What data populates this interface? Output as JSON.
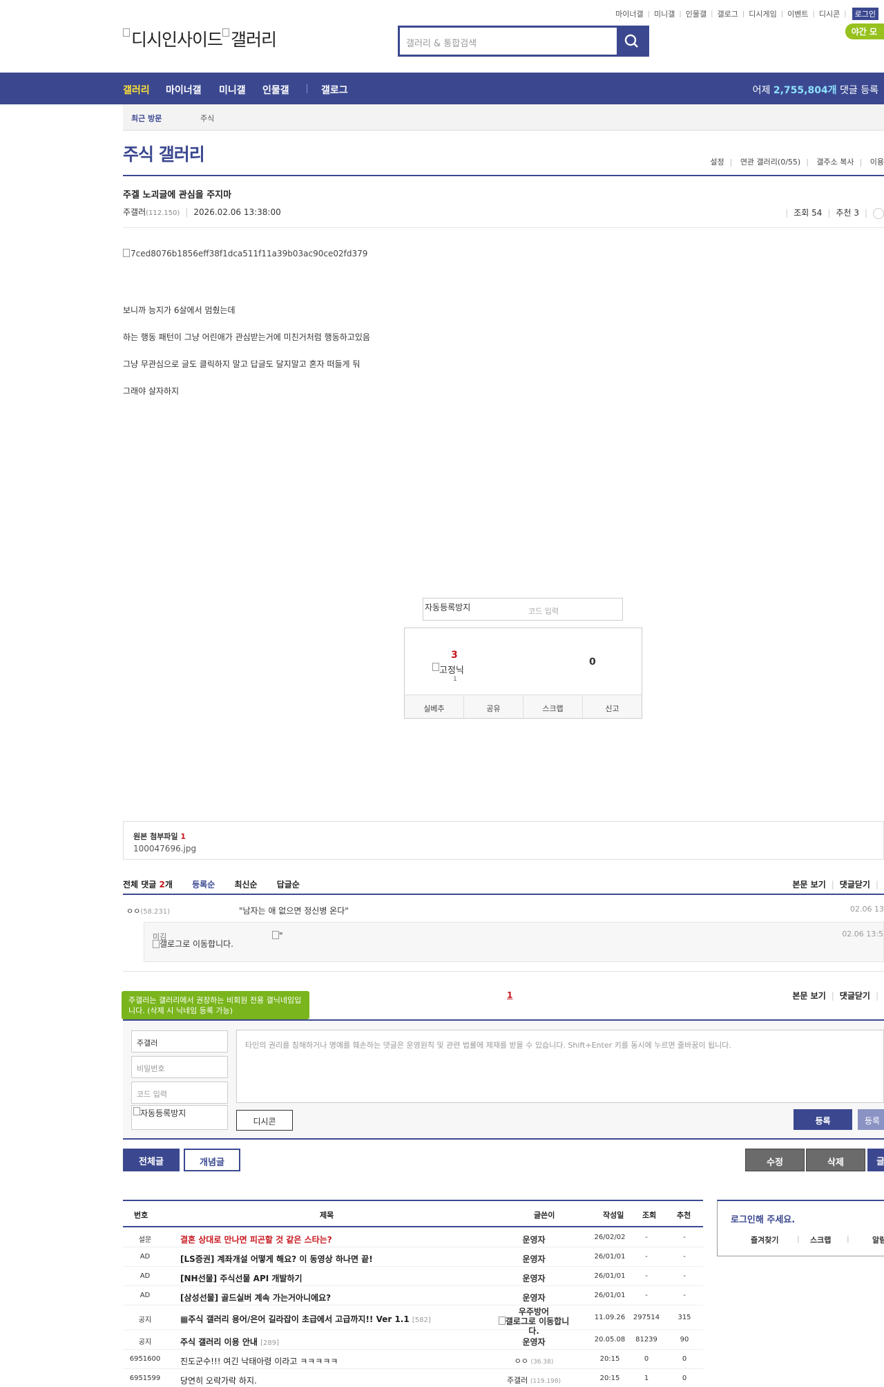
{
  "util_links": [
    "마이너갤",
    "미니갤",
    "인물갤",
    "갤로그",
    "디시게임",
    "이벤트",
    "디시콘"
  ],
  "login_label": "로그인",
  "night_mode": "야간 모",
  "logo": {
    "part1": "디시인사이드",
    "part2": "갤러리"
  },
  "search": {
    "placeholder": "갤러리 & 통합검색"
  },
  "nav": {
    "items": [
      "갤러리",
      "마이너갤",
      "미니갤",
      "인물갤",
      "갤로그"
    ],
    "comment_prefix": "어제 ",
    "comment_count": "2,755,804개",
    "comment_suffix": " 댓글 등록"
  },
  "recent": {
    "title": "최근 방문",
    "item": "주식"
  },
  "gallery": {
    "title": "주식 갤러리",
    "tools": [
      "설정",
      "연관 갤러리(0/55)",
      "갤주소 복사",
      "이용"
    ]
  },
  "post": {
    "title": "주겔 노괴글에 관심을 주지마",
    "writer": "주갤러",
    "ip": "(112.150)",
    "date": "2026.02.06 13:38:00",
    "views": "조회 54",
    "recommend": "추천 3",
    "image_alt": "7ced8076b1856eff38f1dca511f11a39b03ac90ce02fd379",
    "body": [
      "보니까 능지가 6살에서 멈췄는데",
      "하는 행동 패턴이 그냥 어린애가 관심받는거에 미친거처럼 행동하고있음",
      "그냥 무관심으로 글도 클릭하지 말고 답글도 달지말고 혼자 떠들게 둬",
      "그래야 살자하지"
    ]
  },
  "captcha": {
    "alt": "자동등록방지",
    "placeholder": "코드 입력"
  },
  "recommend_box": {
    "up_count": "3",
    "fixed_label": "고정닉",
    "fixed_count": "1",
    "down_count": "0",
    "buttons": [
      "실베추",
      "공유",
      "스크랩",
      "신고"
    ]
  },
  "attachment": {
    "title": "원본 첨부파일",
    "count": "1",
    "file": "100047696.jpg"
  },
  "comments_header": {
    "total_prefix": "전체 댓글 ",
    "total_count": "2",
    "total_suffix": "개",
    "sorts": [
      "등록순",
      "최신순",
      "답글순"
    ],
    "view_body": "본문 보기",
    "close_comments": "댓글닫기"
  },
  "comments": [
    {
      "name": "ㅇㅇ",
      "ip": "(58.231)",
      "text": "\"남자는 애 없으면 정신병 온다\"",
      "date": "02.06 13"
    }
  ],
  "reply": {
    "name": "미김",
    "gallog": "갤로그로 이동합니다.",
    "img_alt": "\"",
    "date": "02.06 13:5"
  },
  "pager": {
    "current": "1"
  },
  "tooltip": "주갤러는 갤러리에서 권장하는 비회원 전용 갤닉네임입니다. (삭제 시 닉네임 등록 가능)",
  "write": {
    "nick_value": "주갤러",
    "password_placeholder": "비밀번호",
    "code_placeholder": "코드 입력",
    "captcha_alt": "자동등록방지",
    "textarea_placeholder": "타인의 권리를 침해하거나 명예를 훼손하는 댓글은 운영원칙 및 관련 법률에 제재를 받을 수 있습니다. Shift+Enter 키를 동시에 누르면 줄바꿈이 됩니다.",
    "dccon": "디시콘",
    "submit": "등록",
    "submit2": "등록"
  },
  "bottom_buttons": {
    "all": "전체글",
    "best": "개념글",
    "edit": "수정",
    "delete": "삭제",
    "write": "글"
  },
  "list": {
    "headers": [
      "번호",
      "제목",
      "글쓴이",
      "작성일",
      "조회",
      "추천"
    ],
    "rows": [
      {
        "num": "설문",
        "title": "결혼 상대로 만나면 피곤할 것 같은 스타는?",
        "cnt": "",
        "writer": "운영자",
        "ip": "",
        "date": "26/02/02",
        "views": "-",
        "rec": "-"
      },
      {
        "num": "AD",
        "title": "[LS증권] 계좌개설 어떻게 해요? 이 동영상 하나면 끝!",
        "cnt": "",
        "writer": "운영자",
        "ip": "",
        "date": "26/01/01",
        "views": "-",
        "rec": "-"
      },
      {
        "num": "AD",
        "title": "[NH선물] 주식선물 API 개발하기",
        "cnt": "",
        "writer": "운영자",
        "ip": "",
        "date": "26/01/01",
        "views": "-",
        "rec": "-"
      },
      {
        "num": "AD",
        "title": "[삼성선물] 골드실버 계속 가는거아니에요?",
        "cnt": "",
        "writer": "운영자",
        "ip": "",
        "date": "26/01/01",
        "views": "-",
        "rec": "-"
      },
      {
        "num": "공지",
        "title": "▦주식 갤러리 용어/은어 길라잡이 초급에서 고급까지!! Ver 1.1",
        "cnt": "[582]",
        "writer": "우주방어",
        "ip": "",
        "date": "11.09.26",
        "views": "297514",
        "rec": "315"
      },
      {
        "num": "공지",
        "title": "주식 갤러리 이용 안내",
        "cnt": "[289]",
        "writer": "운영자",
        "ip": "",
        "date": "20.05.08",
        "views": "81239",
        "rec": "90"
      },
      {
        "num": "6951600",
        "title": "진도군수!!! 여긴 낙태아령 이라고 ㅋㅋㅋㅋㅋ",
        "cnt": "",
        "writer": "ㅇㅇ",
        "ip": "(36.38)",
        "date": "20:15",
        "views": "0",
        "rec": "0"
      },
      {
        "num": "6951599",
        "title": "당연히 오락가락 하지.",
        "cnt": "",
        "writer": "주갤러",
        "ip": "(119.198)",
        "date": "20:15",
        "views": "1",
        "rec": "0"
      }
    ],
    "gallog_alt": "갤로그로 이동합니다."
  },
  "login_box": {
    "title": "로그인해 주세요.",
    "links": [
      "즐겨찾기",
      "스크랩",
      "알림"
    ]
  }
}
